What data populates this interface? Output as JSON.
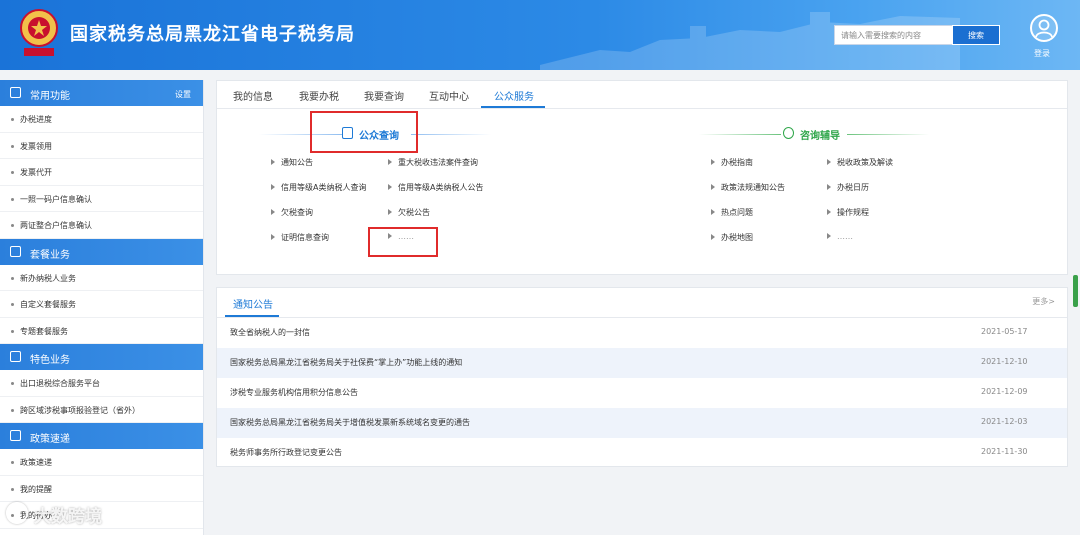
{
  "header": {
    "title": "国家税务总局黑龙江省电子税务局",
    "search_placeholder": "请输入需要搜索的内容",
    "search_button": "搜索",
    "login_label": "登录"
  },
  "sidebar": {
    "sections": [
      {
        "title": "常用功能",
        "setting": "设置",
        "items": [
          "办税进度",
          "发票领用",
          "发票代开",
          "一照一码户信息确认",
          "两证整合户信息确认"
        ]
      },
      {
        "title": "套餐业务",
        "items": [
          "新办纳税人业务",
          "自定义套餐服务",
          "专题套餐服务"
        ]
      },
      {
        "title": "特色业务",
        "items": [
          "出口退税综合服务平台",
          "跨区域涉税事项报验登记（省外）"
        ]
      },
      {
        "title": "政策速递",
        "items": [
          "政策速递",
          "我的提醒",
          "我的待办"
        ]
      }
    ]
  },
  "tabs": [
    "我的信息",
    "我要办税",
    "我要查询",
    "互动中心",
    "公众服务"
  ],
  "active_tab": "公众服务",
  "public_query": {
    "title": "公众查询",
    "col1": [
      "通知公告",
      "信用等级A类纳税人查询",
      "欠税查询",
      "证明信息查询"
    ],
    "col2": [
      "重大税收违法案件查询",
      "信用等级A类纳税人公告",
      "欠税公告",
      "……"
    ]
  },
  "consult": {
    "title": "咨询辅导",
    "col1": [
      "办税指南",
      "政策法规通知公告",
      "热点问题",
      "办税地图"
    ],
    "col2": [
      "税收政策及解读",
      "办税日历",
      "操作规程",
      "……"
    ]
  },
  "notice": {
    "tab": "通知公告",
    "more": "更多>",
    "rows": [
      {
        "title": "致全省纳税人的一封信",
        "date": "2021-05-17"
      },
      {
        "title": "国家税务总局黑龙江省税务局关于社保费“掌上办”功能上线的通知",
        "date": "2021-12-10"
      },
      {
        "title": "涉税专业服务机构信用积分信息公告",
        "date": "2021-12-09"
      },
      {
        "title": "国家税务总局黑龙江省税务局关于增值税发票新系统域名变更的通告",
        "date": "2021-12-03"
      },
      {
        "title": "税务师事务所行政登记变更公告",
        "date": "2021-11-30"
      }
    ]
  },
  "watermark": "大数跨境",
  "colors": {
    "primary": "#1e7ad6",
    "header": "#2c8ae6",
    "green": "#2fa64a",
    "highlight_box": "#e02b2b"
  }
}
